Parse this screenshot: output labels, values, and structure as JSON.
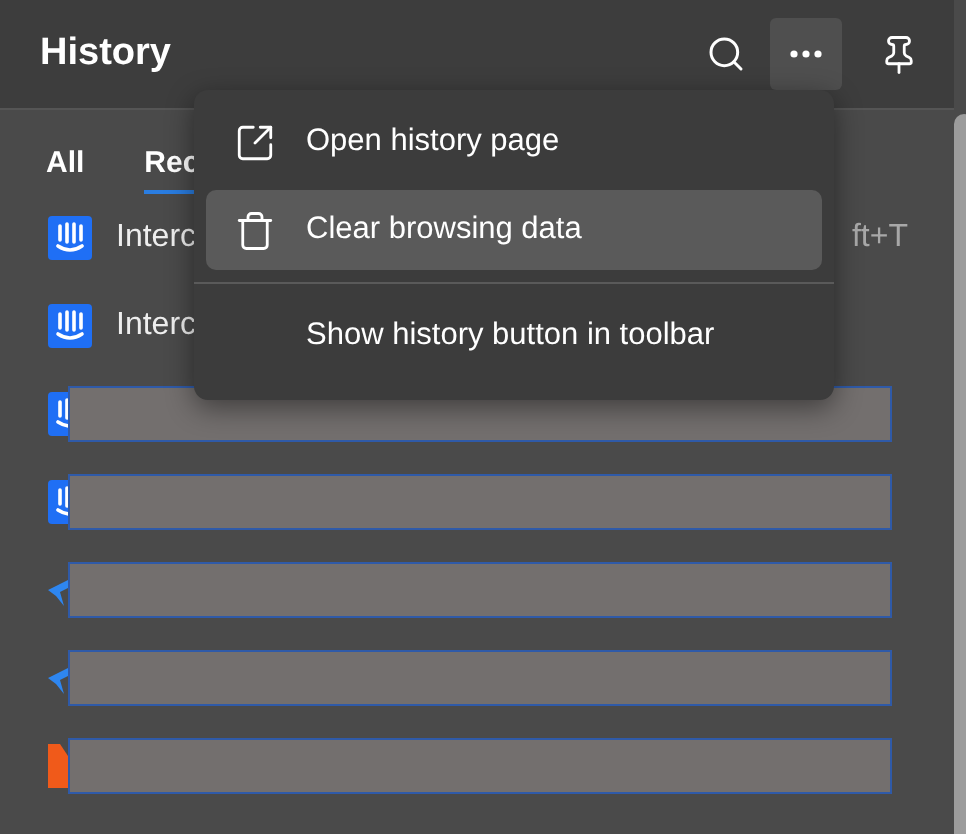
{
  "header": {
    "title": "History"
  },
  "tabs": [
    {
      "label": "All",
      "selected": false
    },
    {
      "label": "Rec",
      "selected": true
    }
  ],
  "items": [
    {
      "kind": "text",
      "title": "Interc",
      "shortcut": "ft+T"
    },
    {
      "kind": "text",
      "title": "Interc"
    },
    {
      "kind": "redacted"
    },
    {
      "kind": "redacted"
    },
    {
      "kind": "redacted"
    },
    {
      "kind": "redacted"
    },
    {
      "kind": "redacted"
    }
  ],
  "menu": {
    "items": [
      {
        "kind": "item",
        "label": "Open history page",
        "selected": false
      },
      {
        "kind": "item",
        "label": "Clear browsing data",
        "selected": true
      },
      {
        "kind": "divider"
      },
      {
        "kind": "item",
        "label": "Show history button in toolbar",
        "selected": false
      }
    ]
  }
}
